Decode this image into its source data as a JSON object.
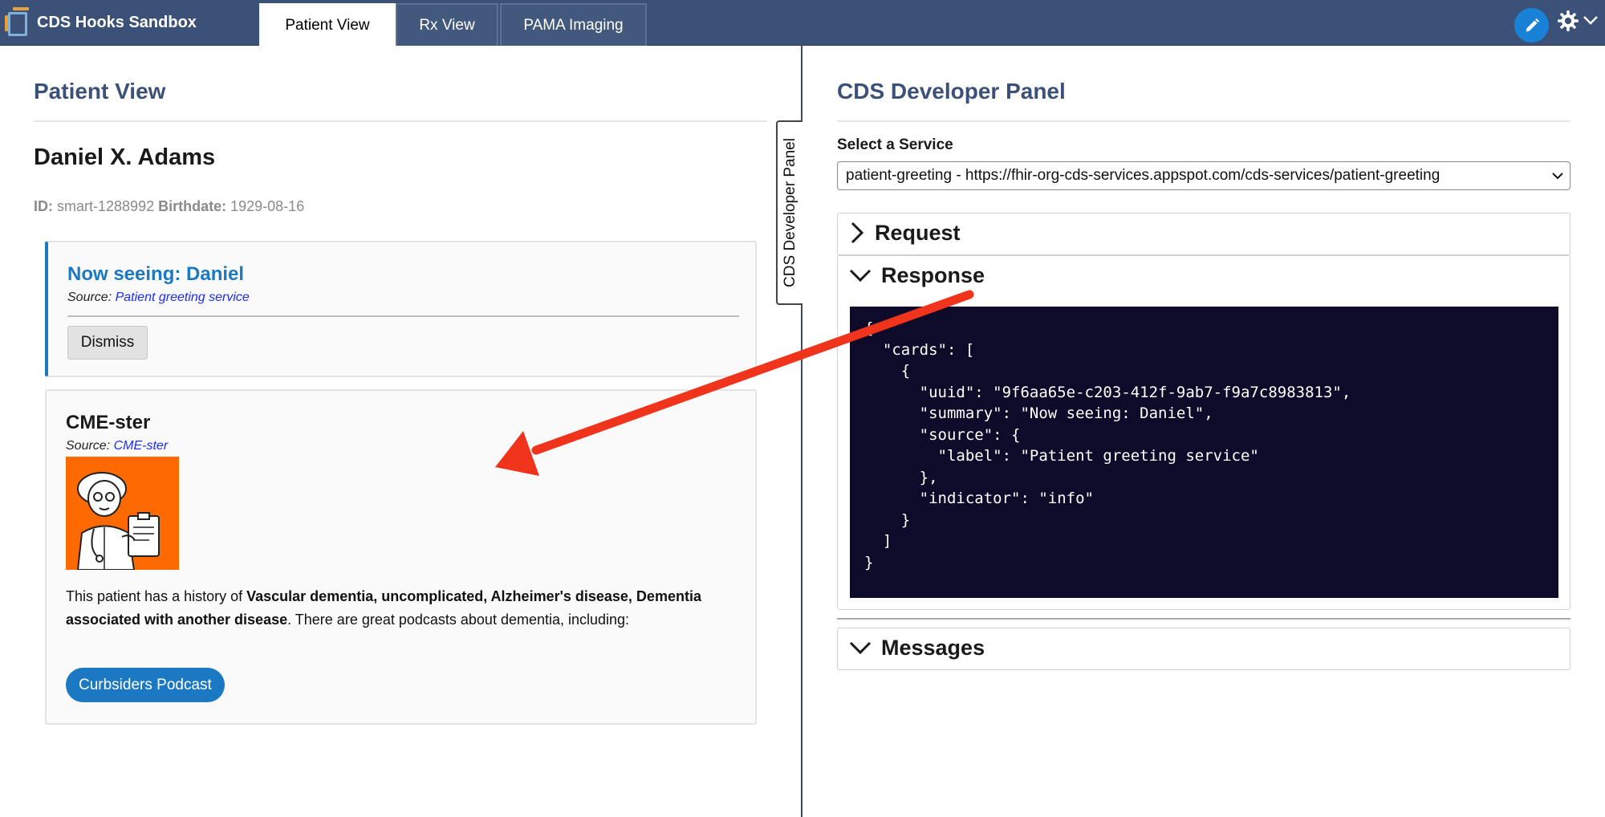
{
  "header": {
    "brand": "CDS Hooks Sandbox",
    "tabs": [
      {
        "label": "Patient View",
        "active": true
      },
      {
        "label": "Rx View",
        "active": false
      },
      {
        "label": "PAMA Imaging",
        "active": false
      }
    ]
  },
  "patient_view": {
    "title": "Patient View",
    "patient_name": "Daniel X. Adams",
    "id_label": "ID:",
    "id_value": "smart-1288992",
    "birthdate_label": "Birthdate:",
    "birthdate_value": "1929-08-16"
  },
  "cards": {
    "greeting": {
      "title": "Now seeing: Daniel",
      "source_label": "Source:",
      "source_link": "Patient greeting service",
      "dismiss_label": "Dismiss"
    },
    "cme": {
      "title": "CME-ster",
      "source_label": "Source:",
      "source_link": "CME-ster",
      "text_1": "This patient has a history of ",
      "text_bold": "Vascular dementia, uncomplicated, Alzheimer's disease, Dementia associated with another disease",
      "text_2": ". There are great podcasts about dementia, including:",
      "button_label": "Curbsiders Podcast"
    }
  },
  "dev_tab_label": "CDS Developer Panel",
  "developer_panel": {
    "title": "CDS Developer Panel",
    "select_label": "Select a Service",
    "selected_service": "patient-greeting - https://fhir-org-cds-services.appspot.com/cds-services/patient-greeting",
    "request_label": "Request",
    "response_label": "Response",
    "response_json": "{\n  \"cards\": [\n    {\n      \"uuid\": \"9f6aa65e-c203-412f-9ab7-f9a7c8983813\",\n      \"summary\": \"Now seeing: Daniel\",\n      \"source\": {\n        \"label\": \"Patient greeting service\"\n      },\n      \"indicator\": \"info\"\n    }\n  ]\n}",
    "messages_label": "Messages"
  },
  "colors": {
    "nav_bg": "#3b5177",
    "accent_blue": "#1b78c2",
    "arrow_red": "#f0341c",
    "code_bg": "#0e0a2a"
  }
}
